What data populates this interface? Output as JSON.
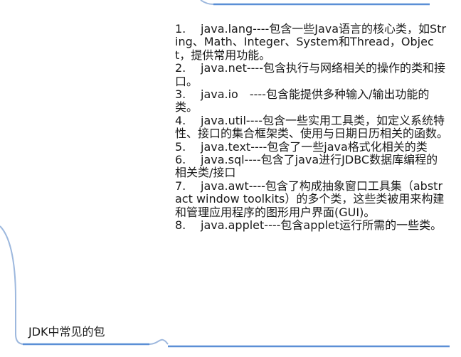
{
  "mindmap": {
    "topic": "JDK中常见的包",
    "items": [
      {
        "num": "1.",
        "text": "java.lang----包含一些Java语言的核心类，如String、Math、Integer、System和Thread，Object，提供常用功能。"
      },
      {
        "num": "2.",
        "text": "java.net----包含执行与网络相关的操作的类和接口。"
      },
      {
        "num": "3.",
        "text": "java.io　----包含能提供多种输入/输出功能的类。"
      },
      {
        "num": "4.",
        "text": "java.util----包含一些实用工具类，如定义系统特性、接口的集合框架类、使用与日期日历相关的函数。"
      },
      {
        "num": "5.",
        "text": "java.text----包含了一些java格式化相关的类"
      },
      {
        "num": "6.",
        "text": "java.sql----包含了java进行JDBC数据库编程的相关类/接口"
      },
      {
        "num": "7.",
        "text": "java.awt----包含了构成抽象窗口工具集（abstract window toolkits）的多个类，这些类被用来构建和管理应用程序的图形用户界面(GUI)。"
      },
      {
        "num": "8.",
        "text": "java.applet----包含applet运行所需的一些类。"
      }
    ]
  },
  "colors": {
    "branch": "#9db8de",
    "underline": "#5b8fd6",
    "text": "#1a1a1a"
  }
}
